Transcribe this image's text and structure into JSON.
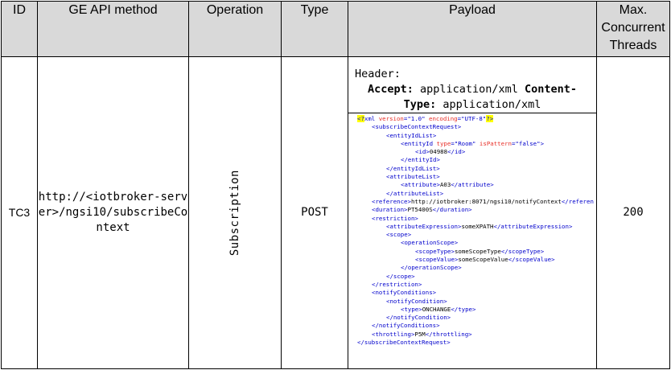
{
  "headers": {
    "id": "ID",
    "method": "GE API method",
    "operation": "Operation",
    "type": "Type",
    "payload": "Payload",
    "threads": "Max. Concurrent Threads"
  },
  "row": {
    "id": "TC3",
    "method": "http://<iotbroker-server>/ngsi10/subscribeContext",
    "operation": "Subscription",
    "type": "POST",
    "threads": "200",
    "header_title": "Header:",
    "accept_label": "Accept:",
    "accept_value": " application/xml ",
    "content_label_1": "Content-",
    "content_label_2": "Type:",
    "content_value": " application/xml"
  },
  "xml_lines": [
    {
      "indent": 0,
      "parts": [
        {
          "c": "pi",
          "t": "<?"
        },
        {
          "c": "tag",
          "t": "xml "
        },
        {
          "c": "attr",
          "t": "version"
        },
        {
          "c": "tag",
          "t": "=\"1.0\" "
        },
        {
          "c": "attr",
          "t": "encoding"
        },
        {
          "c": "tag",
          "t": "=\"UTF-8\""
        },
        {
          "c": "pi",
          "t": "?>"
        }
      ]
    },
    {
      "indent": 1,
      "parts": [
        {
          "c": "tag",
          "t": "<subscribeContextRequest>"
        }
      ]
    },
    {
      "indent": 2,
      "parts": [
        {
          "c": "tag",
          "t": "<entityIdList>"
        }
      ]
    },
    {
      "indent": 3,
      "parts": [
        {
          "c": "tag",
          "t": "<entityId "
        },
        {
          "c": "attr",
          "t": "type"
        },
        {
          "c": "tag",
          "t": "=\"Room\" "
        },
        {
          "c": "attr",
          "t": "isPattern"
        },
        {
          "c": "tag",
          "t": "=\"false\">"
        }
      ]
    },
    {
      "indent": 4,
      "parts": [
        {
          "c": "tag",
          "t": "<id>"
        },
        {
          "c": "txt",
          "t": "04988"
        },
        {
          "c": "tag",
          "t": "</id>"
        }
      ]
    },
    {
      "indent": 3,
      "parts": [
        {
          "c": "tag",
          "t": "</entityId>"
        }
      ]
    },
    {
      "indent": 2,
      "parts": [
        {
          "c": "tag",
          "t": "</entityIdList>"
        }
      ]
    },
    {
      "indent": 2,
      "parts": [
        {
          "c": "tag",
          "t": "<attributeList>"
        }
      ]
    },
    {
      "indent": 3,
      "parts": [
        {
          "c": "tag",
          "t": "<attribute>"
        },
        {
          "c": "txt",
          "t": "A03"
        },
        {
          "c": "tag",
          "t": "</attribute>"
        }
      ]
    },
    {
      "indent": 2,
      "parts": [
        {
          "c": "tag",
          "t": "</attributeList>"
        }
      ]
    },
    {
      "indent": 1,
      "parts": [
        {
          "c": "tag",
          "t": "<reference>"
        },
        {
          "c": "txt",
          "t": "http://iotbroker:8071/ngsi10/notifyContext"
        },
        {
          "c": "tag",
          "t": "</referen"
        }
      ]
    },
    {
      "indent": 1,
      "parts": [
        {
          "c": "tag",
          "t": "<duration>"
        },
        {
          "c": "txt",
          "t": "PT5400S"
        },
        {
          "c": "tag",
          "t": "</duration>"
        }
      ]
    },
    {
      "indent": 1,
      "parts": [
        {
          "c": "tag",
          "t": "<restriction>"
        }
      ]
    },
    {
      "indent": 2,
      "parts": [
        {
          "c": "tag",
          "t": "<attributeExpression>"
        },
        {
          "c": "txt",
          "t": "someXPATH"
        },
        {
          "c": "tag",
          "t": "</attributeExpression>"
        }
      ]
    },
    {
      "indent": 2,
      "parts": [
        {
          "c": "tag",
          "t": "<scope>"
        }
      ]
    },
    {
      "indent": 3,
      "parts": [
        {
          "c": "tag",
          "t": "<operationScope>"
        }
      ]
    },
    {
      "indent": 4,
      "parts": [
        {
          "c": "tag",
          "t": "<scopeType>"
        },
        {
          "c": "txt",
          "t": "someScopeType"
        },
        {
          "c": "tag",
          "t": "</scopeType>"
        }
      ]
    },
    {
      "indent": 4,
      "parts": [
        {
          "c": "tag",
          "t": "<scopeValue>"
        },
        {
          "c": "txt",
          "t": "someScopeValue"
        },
        {
          "c": "tag",
          "t": "</scopeValue>"
        }
      ]
    },
    {
      "indent": 3,
      "parts": [
        {
          "c": "tag",
          "t": "</operationScope>"
        }
      ]
    },
    {
      "indent": 2,
      "parts": [
        {
          "c": "tag",
          "t": "</scope>"
        }
      ]
    },
    {
      "indent": 1,
      "parts": [
        {
          "c": "tag",
          "t": "</restriction>"
        }
      ]
    },
    {
      "indent": 1,
      "parts": [
        {
          "c": "tag",
          "t": "<notifyConditions>"
        }
      ]
    },
    {
      "indent": 2,
      "parts": [
        {
          "c": "tag",
          "t": "<notifyCondition>"
        }
      ]
    },
    {
      "indent": 3,
      "parts": [
        {
          "c": "tag",
          "t": "<type>"
        },
        {
          "c": "txt",
          "t": "ONCHANGE"
        },
        {
          "c": "tag",
          "t": "</type>"
        }
      ]
    },
    {
      "indent": 2,
      "parts": [
        {
          "c": "tag",
          "t": "</notifyCondition>"
        }
      ]
    },
    {
      "indent": 1,
      "parts": [
        {
          "c": "tag",
          "t": "</notifyConditions>"
        }
      ]
    },
    {
      "indent": 1,
      "parts": [
        {
          "c": "tag",
          "t": "<throttling>"
        },
        {
          "c": "txt",
          "t": "P5M"
        },
        {
          "c": "tag",
          "t": "</throttling>"
        }
      ]
    },
    {
      "indent": 0,
      "parts": [
        {
          "c": "tag",
          "t": "</subscribeContextRequest>"
        }
      ]
    }
  ]
}
